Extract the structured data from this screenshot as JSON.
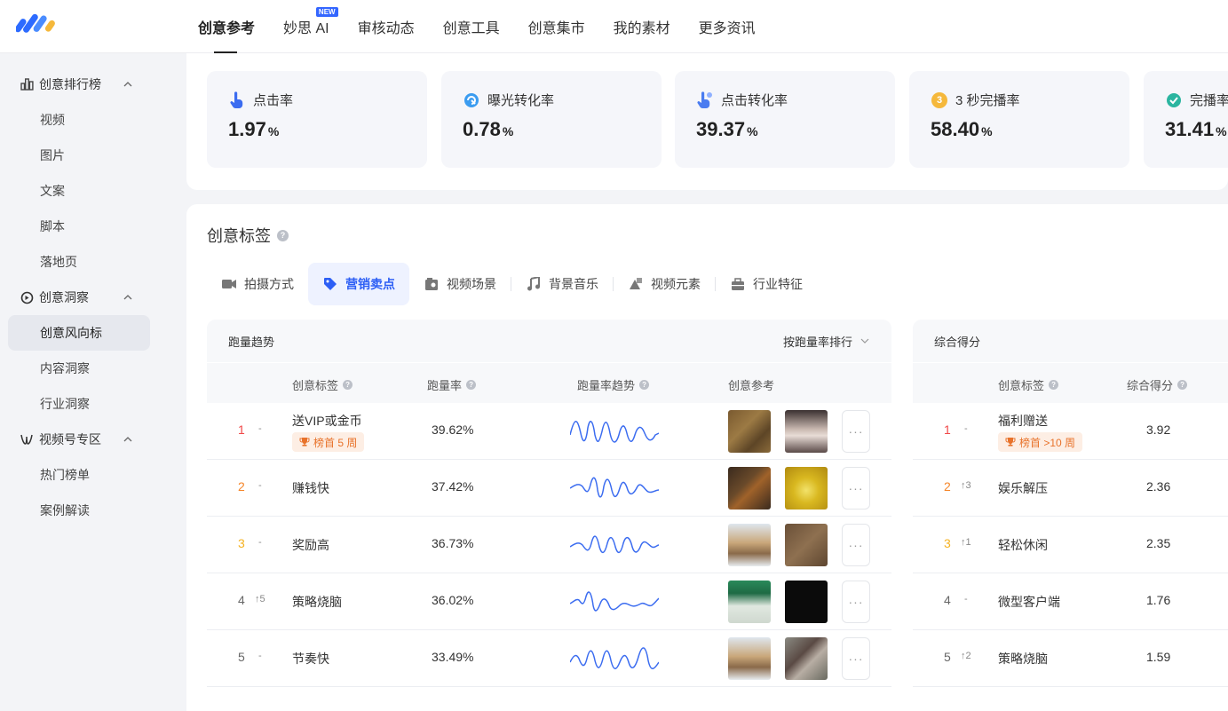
{
  "nav": {
    "items": [
      "创意参考",
      "妙思 AI",
      "审核动态",
      "创意工具",
      "创意集市",
      "我的素材",
      "更多资讯"
    ],
    "active_index": 0,
    "new_badge": "NEW"
  },
  "sidebar": {
    "groups": [
      {
        "label": "创意排行榜",
        "icon": "bar-chart-icon",
        "items": [
          "视频",
          "图片",
          "文案",
          "脚本",
          "落地页"
        ]
      },
      {
        "label": "创意洞察",
        "icon": "insight-icon",
        "items": [
          "创意风向标",
          "内容洞察",
          "行业洞察"
        ]
      },
      {
        "label": "视频号专区",
        "icon": "channels-icon",
        "items": [
          "热门榜单",
          "案例解读"
        ]
      }
    ],
    "active_item": "创意风向标"
  },
  "metrics": [
    {
      "label": "点击率",
      "value": "1.97",
      "unit": "%",
      "icon": "hand-pointer-icon"
    },
    {
      "label": "曝光转化率",
      "value": "0.78",
      "unit": "%",
      "icon": "exposure-icon"
    },
    {
      "label": "点击转化率",
      "value": "39.37",
      "unit": "%",
      "icon": "click-convert-icon"
    },
    {
      "label": "3 秒完播率",
      "value": "58.40",
      "unit": "%",
      "icon": "three-seconds-icon",
      "icon_text": "3"
    },
    {
      "label": "完播率",
      "value": "31.41",
      "unit": "%",
      "icon": "check-circle-icon"
    }
  ],
  "tags_section": {
    "title": "创意标签",
    "tabs": [
      "拍摄方式",
      "营销卖点",
      "视频场景",
      "背景音乐",
      "视频元素",
      "行业特征"
    ],
    "active_tab": 1
  },
  "trend_panel": {
    "title": "跑量趋势",
    "sort_label": "按跑量率排行",
    "columns": [
      "创意标签",
      "跑量率",
      "跑量率趋势",
      "创意参考"
    ],
    "more_label": "···",
    "rows": [
      {
        "rank": "1",
        "delta": "-",
        "tag": "送VIP或金币",
        "badge": "榜首 5 周",
        "rate": "39.62%"
      },
      {
        "rank": "2",
        "delta": "-",
        "tag": "赚钱快",
        "badge": "",
        "rate": "37.42%"
      },
      {
        "rank": "3",
        "delta": "-",
        "tag": "奖励高",
        "badge": "",
        "rate": "36.73%"
      },
      {
        "rank": "4",
        "delta": "↑5",
        "tag": "策略烧脑",
        "badge": "",
        "rate": "36.02%"
      },
      {
        "rank": "5",
        "delta": "-",
        "tag": "节奏快",
        "badge": "",
        "rate": "33.49%"
      }
    ]
  },
  "score_panel": {
    "title": "综合得分",
    "columns": [
      "创意标签",
      "综合得分"
    ],
    "rows": [
      {
        "rank": "1",
        "delta": "-",
        "tag": "福利赠送",
        "badge": "榜首 >10 周",
        "score": "3.92"
      },
      {
        "rank": "2",
        "delta": "↑3",
        "tag": "娱乐解压",
        "badge": "",
        "score": "2.36"
      },
      {
        "rank": "3",
        "delta": "↑1",
        "tag": "轻松休闲",
        "badge": "",
        "score": "2.35"
      },
      {
        "rank": "4",
        "delta": "-",
        "tag": "微型客户端",
        "badge": "",
        "score": "1.76"
      },
      {
        "rank": "5",
        "delta": "↑2",
        "tag": "策略烧脑",
        "badge": "",
        "score": "1.59"
      }
    ]
  },
  "colors": {
    "accent": "#2d5ff5",
    "rank1": "#f04848",
    "rank2": "#f5862a",
    "rank3": "#f5b222",
    "badge_bg": "#fdeee4",
    "badge_fg": "#e8722a",
    "trend_line": "#3b6cf0"
  }
}
